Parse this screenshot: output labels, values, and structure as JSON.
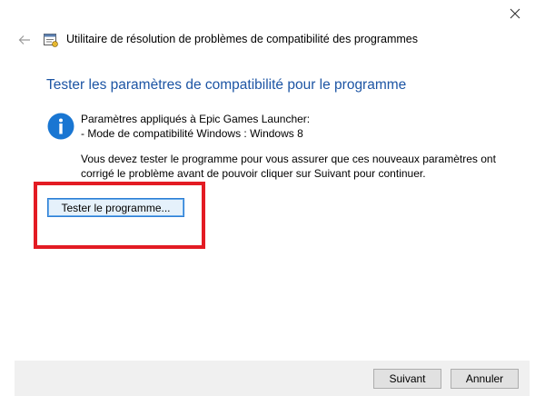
{
  "window": {
    "title": "Utilitaire de résolution de problèmes de compatibilité des programmes",
    "close_icon": "close-icon",
    "back_icon": "back-arrow-icon",
    "app_icon": "troubleshooter-icon"
  },
  "main": {
    "heading": "Tester les paramètres de compatibilité pour le programme",
    "info": {
      "icon": "info-icon",
      "line1": "Paramètres appliqués à Epic Games Launcher:",
      "line2": "- Mode de compatibilité Windows : Windows 8"
    },
    "instructions": {
      "line1": "Vous devez tester le programme pour vous assurer que ces nouveaux paramètres ont",
      "line2": "corrigé le problème avant de pouvoir cliquer sur Suivant pour continuer."
    },
    "test_button_label": "Tester le programme..."
  },
  "footer": {
    "next_label": "Suivant",
    "cancel_label": "Annuler"
  },
  "colors": {
    "heading": "#1d55a4",
    "info_icon": "#1976d2",
    "highlight": "#e31b23",
    "footer_bg": "#f0f0f0"
  }
}
